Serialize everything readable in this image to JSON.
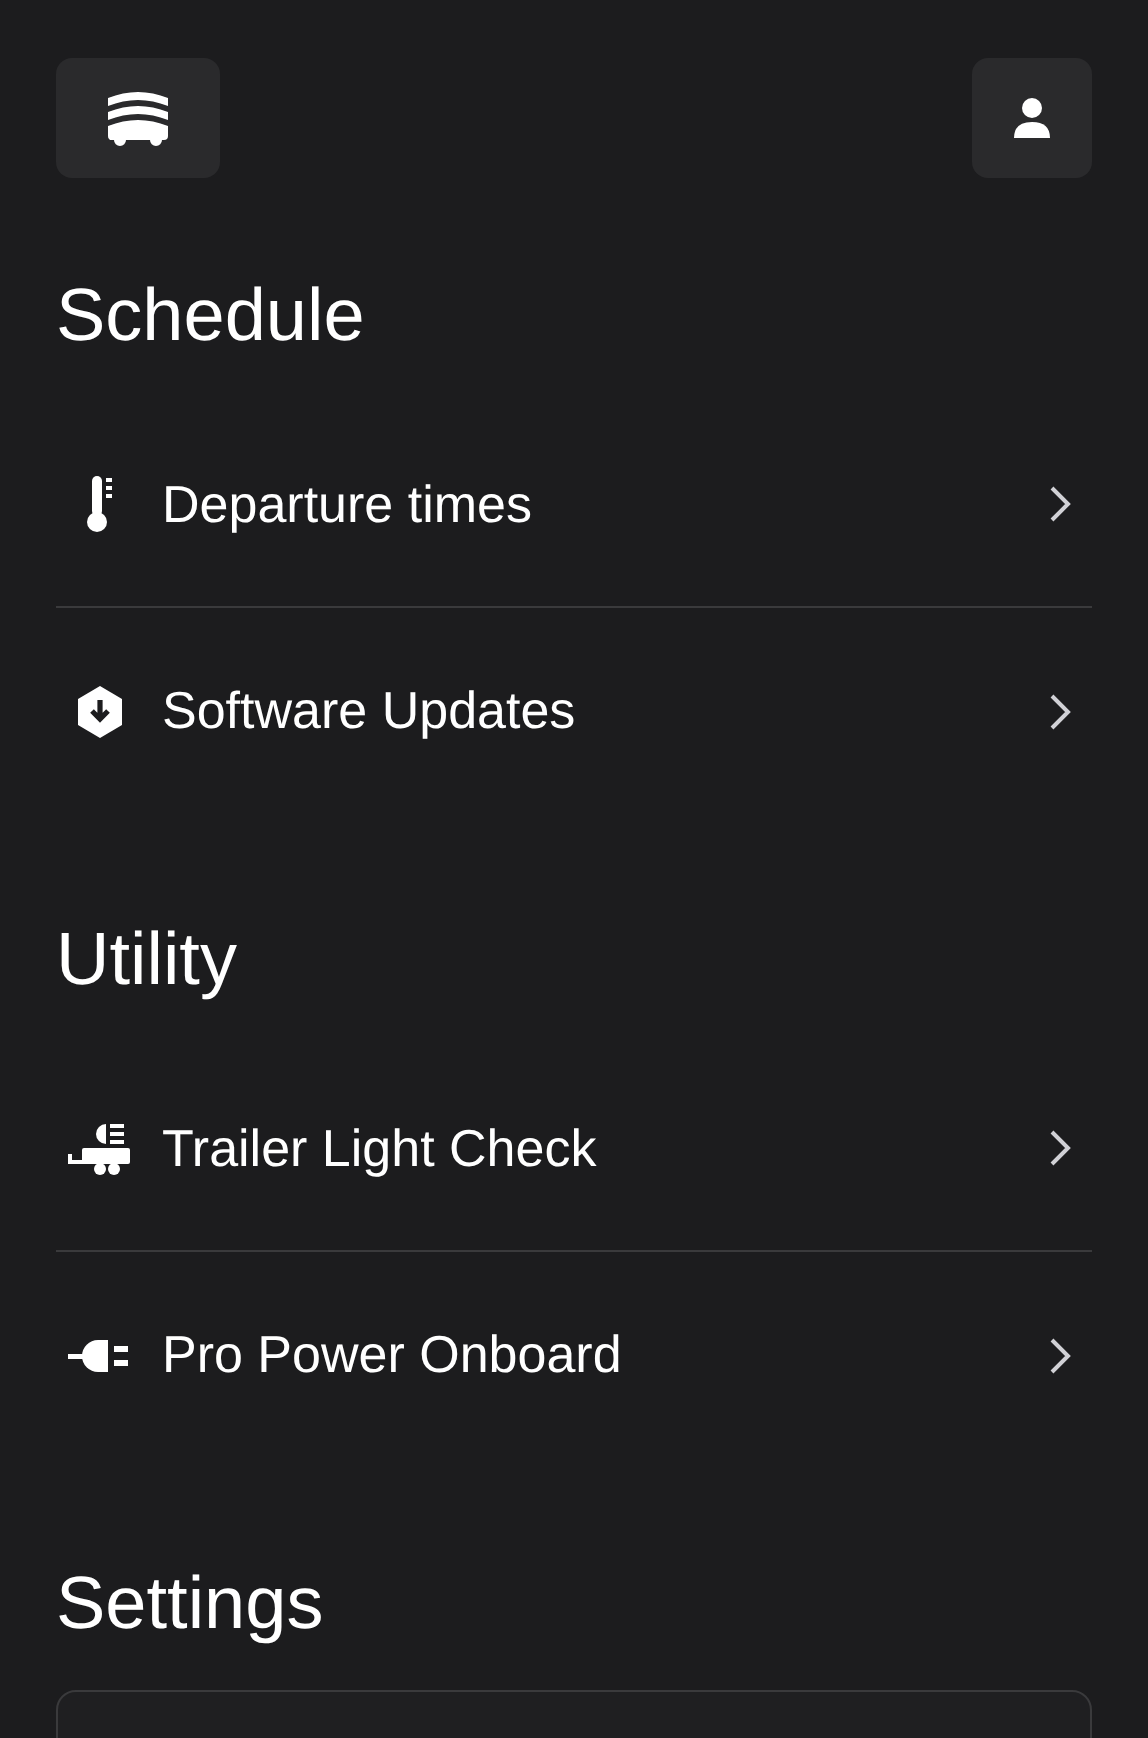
{
  "sections": [
    {
      "title": "Schedule",
      "items": [
        {
          "label": "Departure times"
        },
        {
          "label": "Software Updates"
        }
      ]
    },
    {
      "title": "Utility",
      "items": [
        {
          "label": "Trailer Light Check"
        },
        {
          "label": "Pro Power Onboard"
        }
      ]
    },
    {
      "title": "Settings"
    }
  ]
}
